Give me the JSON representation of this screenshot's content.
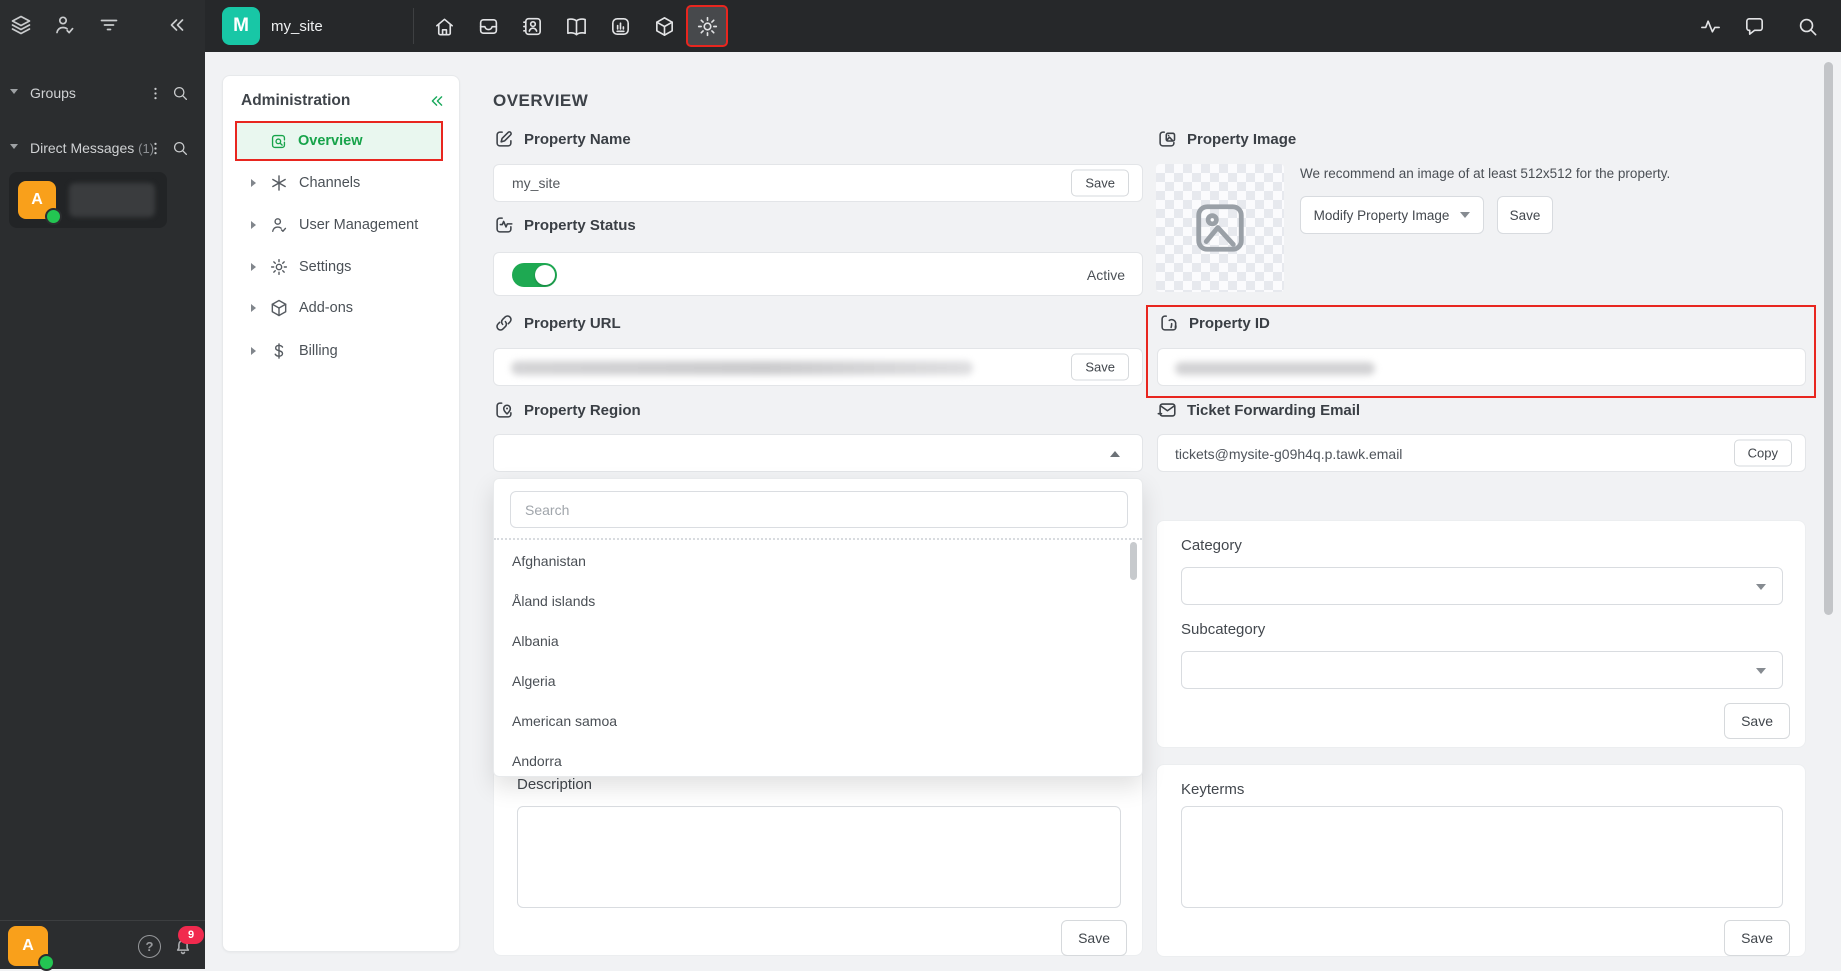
{
  "app": {
    "accent_green": "#1ea952",
    "annotation_red": "#e8261f",
    "brand_teal": "#18c7a6",
    "brand_orange": "#f9a01b",
    "dark_bg": "#2b2d2f"
  },
  "icons": {
    "rail": [
      "layers-icon",
      "person-check-icon",
      "filter-icon",
      "collapse-icon"
    ],
    "top_bar": [
      "home-icon",
      "inbox-icon",
      "contacts-icon",
      "book-icon",
      "dashboard-icon",
      "box-icon",
      "gear-icon"
    ],
    "top_right": [
      "pulse-icon",
      "chat-icon",
      "search-icon"
    ],
    "bottom": [
      "help-icon",
      "bell-icon"
    ]
  },
  "left_rail": {
    "sections": [
      {
        "label": "Groups",
        "count": ""
      },
      {
        "label": "Direct Messages",
        "count": "(1)"
      }
    ],
    "dm_item": {
      "avatar_letter": "A"
    },
    "bottom": {
      "avatar_letter": "A",
      "notification_count": "9"
    }
  },
  "top_bar": {
    "property_initial": "M",
    "property_name": "my_site"
  },
  "admin_panel": {
    "title": "Administration",
    "items": [
      {
        "label": "Overview",
        "active": true
      },
      {
        "label": "Channels"
      },
      {
        "label": "User Management"
      },
      {
        "label": "Settings"
      },
      {
        "label": "Add-ons"
      },
      {
        "label": "Billing"
      }
    ]
  },
  "main": {
    "heading": "OVERVIEW",
    "property_name": {
      "label": "Property Name",
      "value": "my_site",
      "save_label": "Save"
    },
    "property_status": {
      "label": "Property Status",
      "status_text": "Active",
      "enabled": true
    },
    "property_url": {
      "label": "Property URL",
      "save_label": "Save",
      "value_redacted": true
    },
    "property_region": {
      "label": "Property Region",
      "search_placeholder": "Search",
      "options": [
        "Afghanistan",
        "Åland islands",
        "Albania",
        "Algeria",
        "American samoa",
        "Andorra"
      ]
    },
    "description": {
      "label": "Description",
      "value": "",
      "save_label": "Save"
    },
    "property_image": {
      "label": "Property Image",
      "hint": "We recommend an image of at least 512x512 for the property.",
      "modify_label": "Modify Property Image",
      "save_label": "Save"
    },
    "property_id": {
      "label": "Property ID",
      "value_redacted": true
    },
    "ticket_forwarding_email": {
      "label": "Ticket Forwarding Email",
      "value": "tickets@mysite-g09h4q.p.tawk.email",
      "copy_label": "Copy"
    },
    "category_card": {
      "category_label": "Category",
      "subcategory_label": "Subcategory",
      "save_label": "Save"
    },
    "keyterms_card": {
      "label": "Keyterms",
      "value": "",
      "save_label": "Save"
    }
  }
}
